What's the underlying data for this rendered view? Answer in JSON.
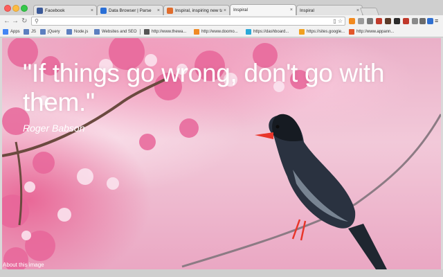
{
  "browser": {
    "tabs": [
      {
        "title": "Facebook",
        "favicon_color": "#3b5998",
        "active": false
      },
      {
        "title": "Data Browser | Parse",
        "favicon_color": "#2a6fd6",
        "active": false
      },
      {
        "title": "Inspiral, inspiring new tab",
        "favicon_color": "#e06c2c",
        "active": false
      },
      {
        "title": "Inspiral",
        "favicon_color": "#f6f6f6",
        "active": true
      },
      {
        "title": "Inspiral",
        "favicon_color": "#f6f6f6",
        "active": false
      }
    ],
    "close_glyph": "×",
    "nav": {
      "back": "←",
      "forward": "→",
      "reload": "↻"
    },
    "address": {
      "value": "",
      "search_glyph": "⚲",
      "action_glyphs": "▯ ☆"
    },
    "extensions": [
      {
        "name": "avast-icon",
        "color": "#f28a1f"
      },
      {
        "name": "grey-ext-icon",
        "color": "#9b9b9b"
      },
      {
        "name": "pause-icon",
        "color": "#7a7a7a"
      },
      {
        "name": "target-icon",
        "color": "#c03a2b"
      },
      {
        "name": "badge-icon",
        "color": "#5a3b2a"
      },
      {
        "name": "shield-icon",
        "color": "#2b2b2b"
      },
      {
        "name": "flag-icon",
        "color": "#c0392b"
      },
      {
        "name": "chat-icon",
        "color": "#8a8a8a"
      },
      {
        "name": "box-icon",
        "color": "#6b6b6b"
      },
      {
        "name": "power-icon",
        "color": "#2f6fd0"
      }
    ],
    "menu_glyph": "≡",
    "bookmarks": [
      {
        "label": "Apps",
        "icon_color": "#4285f4",
        "sep_before": false
      },
      {
        "label": "JS",
        "icon_color": "#5c7fbf",
        "sep_before": false
      },
      {
        "label": "jQuery",
        "icon_color": "#5c7fbf",
        "sep_before": false
      },
      {
        "label": "Node.js",
        "icon_color": "#5c7fbf",
        "sep_before": false
      },
      {
        "label": "Websites and SEO",
        "icon_color": "#5c7fbf",
        "sep_before": false
      },
      {
        "label": "http://www.thewa...",
        "icon_color": "#555555",
        "sep_before": true
      },
      {
        "label": "http://www.doomo...",
        "icon_color": "#f08a24",
        "sep_before": false
      },
      {
        "label": "https://dashboard...",
        "icon_color": "#2aa8d8",
        "sep_before": false
      },
      {
        "label": "https://sites.google...",
        "icon_color": "#f0a020",
        "sep_before": false
      },
      {
        "label": "http://www.appann...",
        "icon_color": "#e2562a",
        "sep_before": false
      }
    ]
  },
  "page": {
    "quote": "\"If things go wrong, don't go with them.\"",
    "author": "Roger Babson",
    "about_link": "About this image"
  }
}
